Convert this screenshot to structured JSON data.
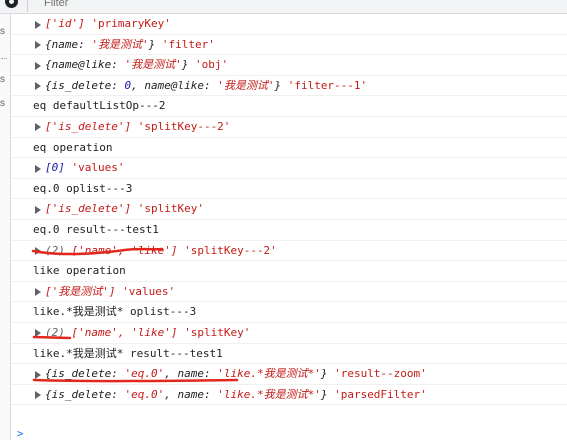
{
  "toolbar": {
    "filter_placeholder": "Filter"
  },
  "sidebar": {
    "labels": [
      "s",
      "s",
      "s",
      "s"
    ]
  },
  "console": {
    "rows": [
      {
        "kind": "obj",
        "parts": [
          {
            "t": "['id']",
            "c": "s i"
          },
          {
            "t": " 'primaryKey'",
            "c": "s"
          }
        ]
      },
      {
        "kind": "obj",
        "parts": [
          {
            "t": "{name: ",
            "c": "d i"
          },
          {
            "t": "'我是测试'",
            "c": "s i"
          },
          {
            "t": "}",
            "c": "d i"
          },
          {
            "t": " 'filter'",
            "c": "s"
          }
        ]
      },
      {
        "kind": "obj",
        "parts": [
          {
            "t": "{name@like: ",
            "c": "d i"
          },
          {
            "t": "'我是测试'",
            "c": "s i"
          },
          {
            "t": "}",
            "c": "d i"
          },
          {
            "t": " 'obj'",
            "c": "s"
          }
        ]
      },
      {
        "kind": "obj",
        "parts": [
          {
            "t": "{is_delete: ",
            "c": "d i"
          },
          {
            "t": "0",
            "c": "n i"
          },
          {
            "t": ", name@like: ",
            "c": "d i"
          },
          {
            "t": "'我是测试'",
            "c": "s i"
          },
          {
            "t": "}",
            "c": "d i"
          },
          {
            "t": " 'filter---1'",
            "c": "s"
          }
        ]
      },
      {
        "kind": "plain",
        "parts": [
          {
            "t": "eq defaultListOp---2",
            "c": "d"
          }
        ]
      },
      {
        "kind": "obj",
        "parts": [
          {
            "t": "['is_delete']",
            "c": "s i"
          },
          {
            "t": " 'splitKey---2'",
            "c": "s"
          }
        ]
      },
      {
        "kind": "plain",
        "parts": [
          {
            "t": "eq operation",
            "c": "d"
          }
        ]
      },
      {
        "kind": "obj",
        "parts": [
          {
            "t": "[0]",
            "c": "n i"
          },
          {
            "t": " 'values'",
            "c": "s"
          }
        ]
      },
      {
        "kind": "plain",
        "parts": [
          {
            "t": "eq.0 oplist---3",
            "c": "d"
          }
        ]
      },
      {
        "kind": "obj",
        "parts": [
          {
            "t": "['is_delete']",
            "c": "s i"
          },
          {
            "t": " 'splitKey'",
            "c": "s"
          }
        ]
      },
      {
        "kind": "plain",
        "parts": [
          {
            "t": "eq.0 result---test1",
            "c": "d"
          }
        ]
      },
      {
        "kind": "obj",
        "parts": [
          {
            "t": "(2) ",
            "c": "grey i"
          },
          {
            "t": "['name', 'like']",
            "c": "s i"
          },
          {
            "t": " 'splitKey---2'",
            "c": "s"
          }
        ]
      },
      {
        "kind": "plain",
        "parts": [
          {
            "t": "like operation",
            "c": "d"
          }
        ]
      },
      {
        "kind": "obj",
        "parts": [
          {
            "t": "['我是测试']",
            "c": "s i"
          },
          {
            "t": " 'values'",
            "c": "s"
          }
        ]
      },
      {
        "kind": "plain",
        "parts": [
          {
            "t": "like.*我是测试* oplist---3",
            "c": "d"
          }
        ]
      },
      {
        "kind": "obj",
        "parts": [
          {
            "t": "(2) ",
            "c": "grey i"
          },
          {
            "t": "['name', 'like']",
            "c": "s i"
          },
          {
            "t": " 'splitKey'",
            "c": "s"
          }
        ]
      },
      {
        "kind": "plain",
        "parts": [
          {
            "t": "like.*我是测试* result---test1",
            "c": "d"
          }
        ]
      },
      {
        "kind": "obj",
        "parts": [
          {
            "t": "{is_delete: ",
            "c": "d i"
          },
          {
            "t": "'eq.0'",
            "c": "s i"
          },
          {
            "t": ", name: ",
            "c": "d i"
          },
          {
            "t": "'like.*我是测试*'",
            "c": "s i"
          },
          {
            "t": "}",
            "c": "d i"
          },
          {
            "t": " 'result--zoom'",
            "c": "s"
          }
        ]
      },
      {
        "kind": "obj",
        "parts": [
          {
            "t": "{is_delete: ",
            "c": "d i"
          },
          {
            "t": "'eq.0'",
            "c": "s i"
          },
          {
            "t": ", name: ",
            "c": "d i"
          },
          {
            "t": "'like.*我是测试*'",
            "c": "s i"
          },
          {
            "t": "}",
            "c": "d i"
          },
          {
            "t": " 'parsedFilter'",
            "c": "s"
          }
        ]
      }
    ],
    "prompt_symbol": ">"
  },
  "colors": {
    "string": "#c41a16",
    "number": "#1a1aa6",
    "annotation": "#e0281e"
  }
}
